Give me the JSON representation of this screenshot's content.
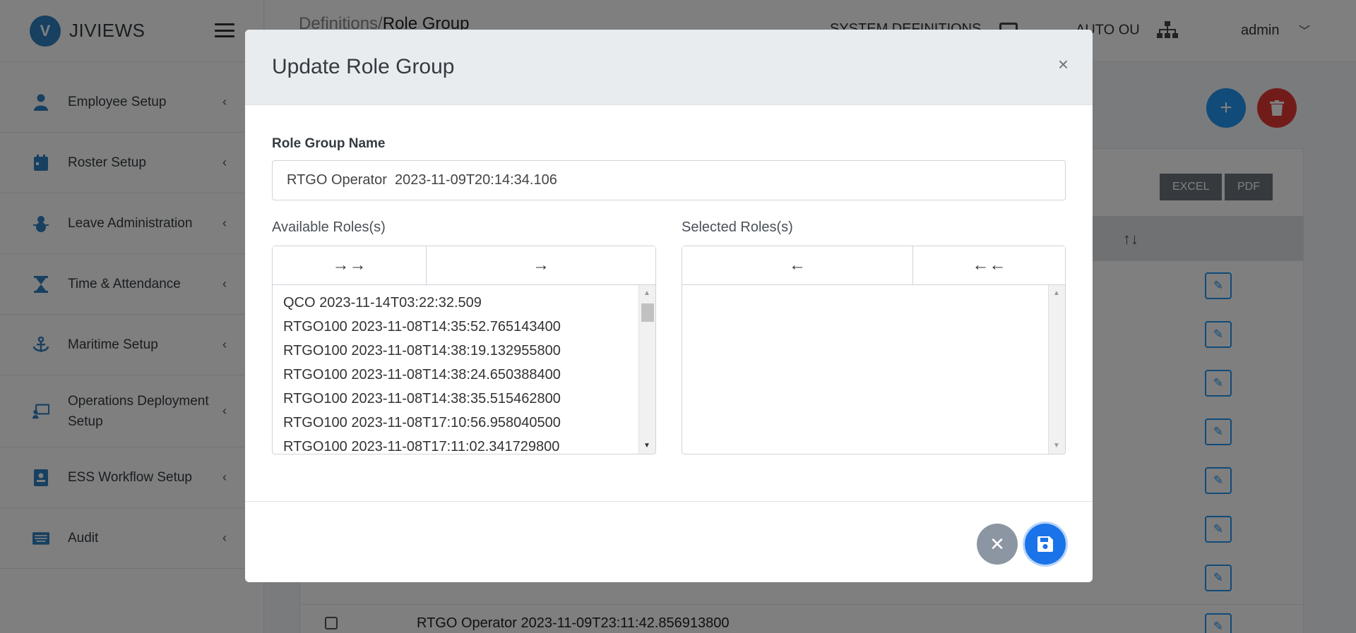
{
  "brand": {
    "logo_letter": "V",
    "name": "JIVIEWS"
  },
  "sidebar": {
    "items": [
      {
        "label": "Employee Setup",
        "icon": "person-icon"
      },
      {
        "label": "Roster Setup",
        "icon": "calendar-icon"
      },
      {
        "label": "Leave Administration",
        "icon": "snowman-icon"
      },
      {
        "label": "Time & Attendance",
        "icon": "hourglass-icon"
      },
      {
        "label": "Maritime Setup",
        "icon": "anchor-icon"
      },
      {
        "label": "Operations Deployment Setup",
        "icon": "presentation-icon"
      },
      {
        "label": "ESS Workflow Setup",
        "icon": "id-card-icon"
      },
      {
        "label": "Audit",
        "icon": "keyboard-icon"
      }
    ]
  },
  "topbar": {
    "breadcrumb_parent": "Definitions/",
    "breadcrumb_current": "Role Group",
    "system_definitions": "SYSTEM DEFINITIONS",
    "auto_ou": "AUTO OU",
    "user": "admin"
  },
  "toolbar": {
    "excel": "EXCEL",
    "pdf": "PDF"
  },
  "table": {
    "visible_row_text": "RTGO Operator 2023-11-09T23:11:42.856913800",
    "visible_row_fragment": "…ator"
  },
  "modal": {
    "title": "Update Role Group",
    "close_glyph": "×",
    "name_label": "Role Group Name",
    "name_value": "RTGO Operator  2023-11-09T20:14:34.106",
    "available_label": "Available Roles(s)",
    "selected_label": "Selected Roles(s)",
    "move_all_right": "→→",
    "move_right": "→",
    "move_left": "←",
    "move_all_left": "←←",
    "available_roles": [
      "QCO 2023-11-14T03:22:32.509",
      "RTGO100 2023-11-08T14:35:52.765143400",
      "RTGO100 2023-11-08T14:38:19.132955800",
      "RTGO100 2023-11-08T14:38:24.650388400",
      "RTGO100 2023-11-08T14:38:35.515462800",
      "RTGO100 2023-11-08T17:10:56.958040500",
      "RTGO100 2023-11-08T17:11:02.341729800"
    ],
    "selected_roles": []
  },
  "colors": {
    "accent": "#1a73e8",
    "add_fab": "#2196f3",
    "delete_fab": "#e53935",
    "cancel": "#8c96a3"
  }
}
